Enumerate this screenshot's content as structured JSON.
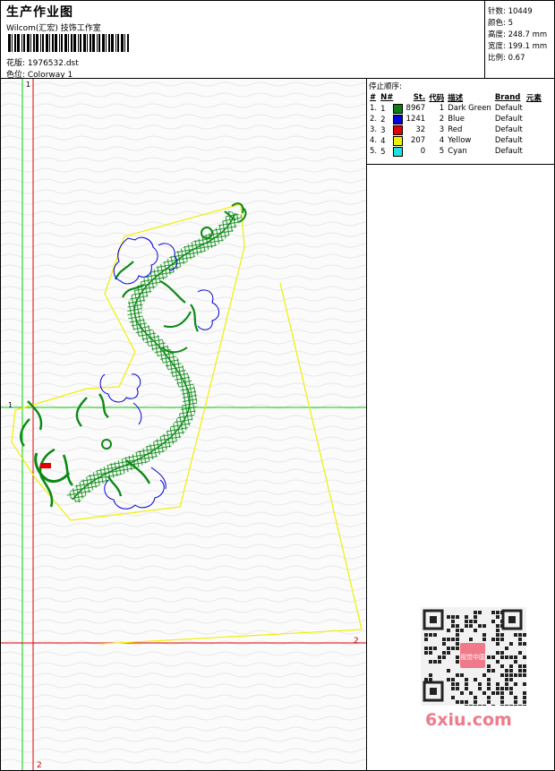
{
  "header": {
    "title": "生产作业图",
    "subtitle": "Wilcom(汇宏) 技饰工作室",
    "file_label": "花版: 1976532.dst",
    "colorway_label": "色位:  Colorway 1"
  },
  "info": {
    "stitches_label": "针数: 10449",
    "colors_label": "颜色: 5",
    "height_label": "高度: 248.7 mm",
    "width_label": "宽度: 199.1 mm",
    "scale_label": "比例: 0.67"
  },
  "stop_sequence": {
    "title": "停止顺序:",
    "headers": [
      "#",
      "N#",
      "St.",
      "代码",
      "描述",
      "Brand",
      "元素"
    ],
    "rows": [
      {
        "n": "1.",
        "nn": "1",
        "color": "#0a7d14",
        "stitches": "8967",
        "code": "1",
        "desc": "Dark Green",
        "brand": "Default"
      },
      {
        "n": "2.",
        "nn": "2",
        "color": "#0000d8",
        "stitches": "1241",
        "code": "2",
        "desc": "Blue",
        "brand": "Default"
      },
      {
        "n": "3.",
        "nn": "3",
        "color": "#e00000",
        "stitches": "32",
        "code": "3",
        "desc": "Red",
        "brand": "Default"
      },
      {
        "n": "4.",
        "nn": "4",
        "color": "#f0f000",
        "stitches": "207",
        "code": "4",
        "desc": "Yellow",
        "brand": "Default"
      },
      {
        "n": "5.",
        "nn": "5",
        "color": "#20e0e0",
        "stitches": "0",
        "code": "5",
        "desc": "Cyan",
        "brand": "Default"
      }
    ]
  },
  "axes": {
    "v_green_label": "1",
    "h_green_label": "1",
    "h_red_label": "2",
    "v_red_label": "2"
  },
  "watermark": {
    "brand_text": "6xiu.com",
    "qr_center_text": "视觉中国"
  }
}
